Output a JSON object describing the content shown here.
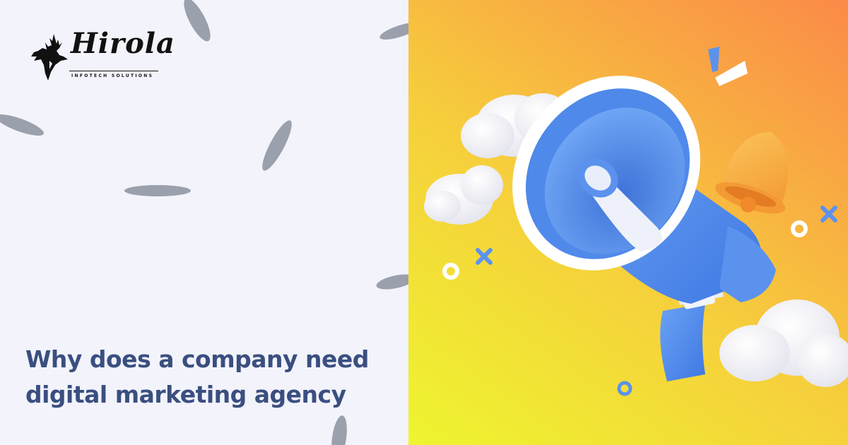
{
  "brand": {
    "name": "Hirola",
    "tagline": "INFOTECH SOLUTIONS"
  },
  "headline": {
    "line1": "Why does a company need",
    "line2": "digital marketing agency"
  },
  "colors": {
    "left_background": "#f3f3fb",
    "headline": "#3a4f80",
    "megaphone_blue": "#4a86ec",
    "bell_orange": "#f6a940"
  },
  "icons": [
    "deer-head-logo-icon",
    "megaphone-icon",
    "bell-icon",
    "cloud-icon",
    "plus-icon",
    "ring-icon"
  ]
}
